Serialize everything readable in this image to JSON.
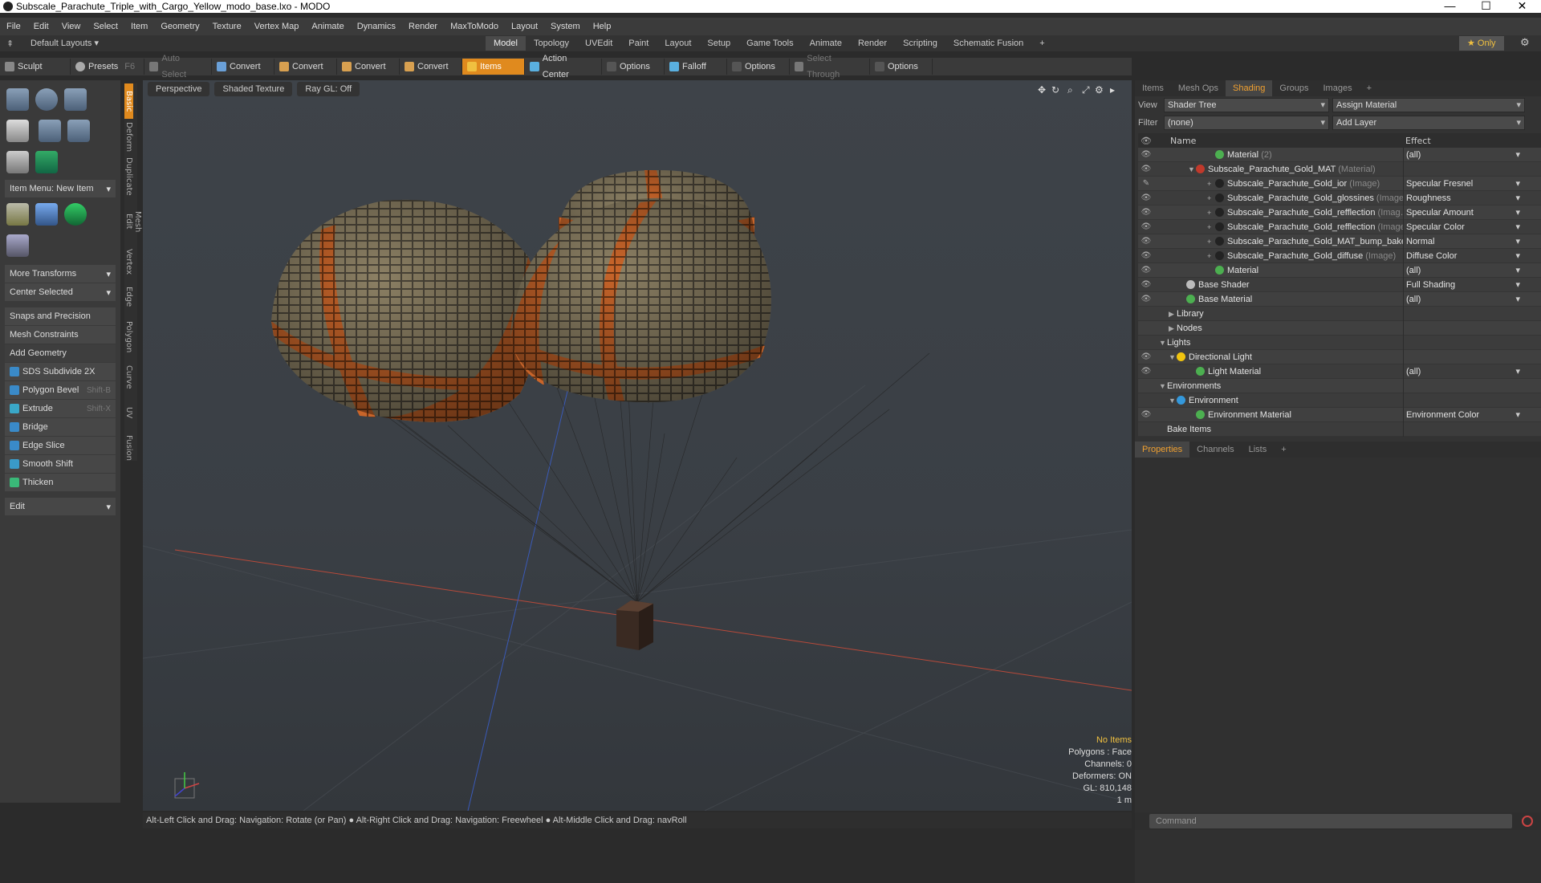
{
  "window": {
    "title": "Subscale_Parachute_Triple_with_Cargo_Yellow_modo_base.lxo - MODO",
    "minimize": "—",
    "maximize": "☐",
    "close": "✕"
  },
  "menu": [
    "File",
    "Edit",
    "View",
    "Select",
    "Item",
    "Geometry",
    "Texture",
    "Vertex Map",
    "Animate",
    "Dynamics",
    "Render",
    "MaxToModo",
    "Layout",
    "System",
    "Help"
  ],
  "layoutbar": {
    "layouts_label": "Default Layouts ▾",
    "tabs": [
      "Model",
      "Topology",
      "UVEdit",
      "Paint",
      "Layout",
      "Setup",
      "Game Tools",
      "Animate",
      "Render",
      "Scripting",
      "Schematic Fusion",
      "+"
    ],
    "active_tab": "Model",
    "only_label": "★  Only"
  },
  "toolbar": {
    "sculpt": "Sculpt",
    "presets": "Presets",
    "presets_key": "F6",
    "items": [
      {
        "label": "Auto Select",
        "state": "dim"
      },
      {
        "label": "Convert",
        "state": "normal"
      },
      {
        "label": "Convert",
        "state": "normal"
      },
      {
        "label": "Convert",
        "state": "normal"
      },
      {
        "label": "Convert",
        "state": "normal"
      },
      {
        "label": "Items",
        "state": "active"
      },
      {
        "label": "Action Center",
        "state": "normal"
      },
      {
        "label": "Options",
        "state": "normal"
      },
      {
        "label": "Falloff",
        "state": "normal"
      },
      {
        "label": "Options",
        "state": "normal"
      },
      {
        "label": "Select Through",
        "state": "dim"
      },
      {
        "label": "Options",
        "state": "normal"
      }
    ]
  },
  "leftpanel": {
    "item_menu": "Item Menu: New Item",
    "more_transforms": "More Transforms",
    "center_selected": "Center Selected",
    "snaps": "Snaps and Precision",
    "mesh_constraints": "Mesh Constraints",
    "add_geometry": "Add Geometry",
    "tools": [
      {
        "label": "SDS Subdivide 2X",
        "shortcut": ""
      },
      {
        "label": "Polygon Bevel",
        "shortcut": "Shift-B"
      },
      {
        "label": "Extrude",
        "shortcut": "Shift-X"
      },
      {
        "label": "Bridge",
        "shortcut": ""
      },
      {
        "label": "Edge Slice",
        "shortcut": ""
      },
      {
        "label": "Smooth Shift",
        "shortcut": ""
      },
      {
        "label": "Thicken",
        "shortcut": ""
      }
    ],
    "edit": "Edit",
    "vtabs": [
      "Basic",
      "Deform",
      "Duplicate",
      "Mesh Edit",
      "Vertex",
      "Edge",
      "Polygon",
      "Curve",
      "UV",
      "Fusion"
    ]
  },
  "viewport": {
    "view": "Perspective",
    "shading": "Shaded Texture",
    "raygl": "Ray GL: Off",
    "info": {
      "items": "No Items",
      "polygons": "Polygons : Face",
      "channels": "Channels: 0",
      "deformers": "Deformers: ON",
      "gl": "GL: 810,148",
      "scale": "1 m"
    }
  },
  "statusbar": "Alt-Left Click and Drag: Navigation: Rotate (or Pan) ● Alt-Right Click and Drag: Navigation: Freewheel ● Alt-Middle Click and Drag: navRoll",
  "rightpanel": {
    "tabs": [
      "Items",
      "Mesh Ops",
      "Shading",
      "Groups",
      "Images",
      "+"
    ],
    "active_tab": "Shading",
    "view_label": "View",
    "view_value": "Shader Tree",
    "assign": "Assign Material",
    "filter_label": "Filter",
    "filter_value": "(none)",
    "add_layer": "Add Layer",
    "col_name": "Name",
    "col_effect": "Effect",
    "rows": [
      {
        "indent": 5,
        "tri": "",
        "dot": "#4caf50",
        "name": "Material",
        "type": "(2)",
        "effect": "(all)",
        "eye": "👁",
        "dd": true
      },
      {
        "indent": 3,
        "tri": "▼",
        "dot": "#c0392b",
        "name": "Subscale_Parachute_Gold_MAT",
        "type": "(Material)",
        "effect": "",
        "eye": "👁",
        "dd": false
      },
      {
        "indent": 5,
        "tri": "+",
        "dot": "#222",
        "name": "Subscale_Parachute_Gold_ior",
        "type": "(Image)",
        "effect": "Specular Fresnel",
        "eye": "✎",
        "dd": true
      },
      {
        "indent": 5,
        "tri": "+",
        "dot": "#222",
        "name": "Subscale_Parachute_Gold_glossines",
        "type": "(Image)",
        "effect": "Roughness",
        "eye": "👁",
        "dd": true
      },
      {
        "indent": 5,
        "tri": "+",
        "dot": "#222",
        "name": "Subscale_Parachute_Gold_refflection",
        "type": "(Imag…",
        "effect": "Specular Amount",
        "eye": "👁",
        "dd": true
      },
      {
        "indent": 5,
        "tri": "+",
        "dot": "#222",
        "name": "Subscale_Parachute_Gold_refflection",
        "type": "(Image)",
        "effect": "Specular Color",
        "eye": "👁",
        "dd": true
      },
      {
        "indent": 5,
        "tri": "+",
        "dot": "#222",
        "name": "Subscale_Parachute_Gold_MAT_bump_bake…",
        "type": "",
        "effect": "Normal",
        "eye": "👁",
        "dd": true
      },
      {
        "indent": 5,
        "tri": "+",
        "dot": "#222",
        "name": "Subscale_Parachute_Gold_diffuse",
        "type": "(Image)",
        "effect": "Diffuse Color",
        "eye": "👁",
        "dd": true
      },
      {
        "indent": 5,
        "tri": "",
        "dot": "#4caf50",
        "name": "Material",
        "type": "",
        "effect": "(all)",
        "eye": "👁",
        "dd": true
      },
      {
        "indent": 2,
        "tri": "",
        "dot": "#bbb",
        "name": "Base Shader",
        "type": "",
        "effect": "Full Shading",
        "eye": "👁",
        "dd": true
      },
      {
        "indent": 2,
        "tri": "",
        "dot": "#4caf50",
        "name": "Base Material",
        "type": "",
        "effect": "(all)",
        "eye": "👁",
        "dd": true
      },
      {
        "indent": 1,
        "tri": "▶",
        "dot": "",
        "name": "Library",
        "type": "",
        "effect": "",
        "eye": "",
        "dd": false
      },
      {
        "indent": 1,
        "tri": "▶",
        "dot": "",
        "name": "Nodes",
        "type": "",
        "effect": "",
        "eye": "",
        "dd": false
      },
      {
        "indent": 0,
        "tri": "▼",
        "dot": "",
        "name": "Lights",
        "type": "",
        "effect": "",
        "eye": "",
        "dd": false
      },
      {
        "indent": 1,
        "tri": "▼",
        "dot": "#f1c40f",
        "name": "Directional Light",
        "type": "",
        "effect": "",
        "eye": "👁",
        "dd": false
      },
      {
        "indent": 3,
        "tri": "",
        "dot": "#4caf50",
        "name": "Light Material",
        "type": "",
        "effect": "(all)",
        "eye": "👁",
        "dd": true
      },
      {
        "indent": 0,
        "tri": "▼",
        "dot": "",
        "name": "Environments",
        "type": "",
        "effect": "",
        "eye": "",
        "dd": false
      },
      {
        "indent": 1,
        "tri": "▼",
        "dot": "#3498db",
        "name": "Environment",
        "type": "",
        "effect": "",
        "eye": "",
        "dd": false
      },
      {
        "indent": 3,
        "tri": "",
        "dot": "#4caf50",
        "name": "Environment Material",
        "type": "",
        "effect": "Environment Color",
        "eye": "👁",
        "dd": true
      },
      {
        "indent": 0,
        "tri": "",
        "dot": "",
        "name": "Bake Items",
        "type": "",
        "effect": "",
        "eye": "",
        "dd": false
      }
    ],
    "bottom_tabs": [
      "Properties",
      "Channels",
      "Lists",
      "+"
    ],
    "command_placeholder": "Command"
  }
}
